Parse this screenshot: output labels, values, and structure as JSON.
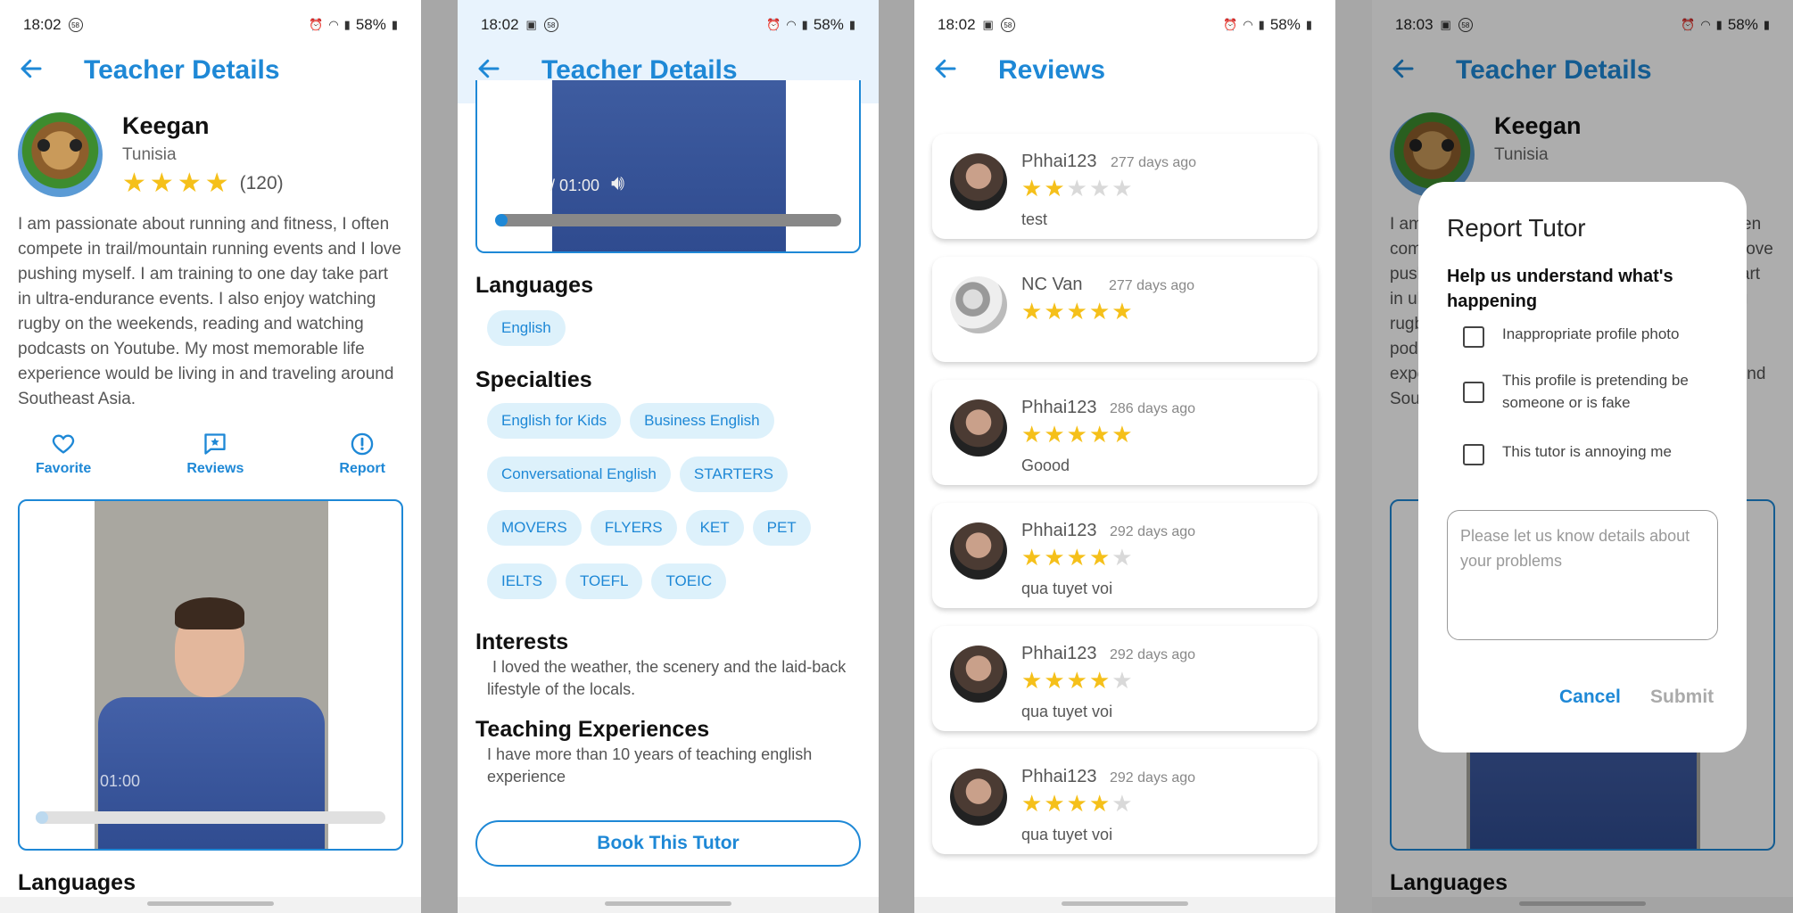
{
  "status": {
    "p1": {
      "time": "18:02",
      "battery": "58%"
    },
    "p2": {
      "time": "18:02",
      "battery": "58%"
    },
    "p3": {
      "time": "18:02",
      "battery": "58%"
    },
    "p4": {
      "time": "18:03",
      "battery": "58%"
    },
    "badge": "58"
  },
  "teacher": {
    "title": "Teacher Details",
    "name": "Keegan",
    "country": "Tunisia",
    "rating_count": "(120)",
    "rating": 4,
    "bio": "I am passionate about running and fitness, I often compete in trail/mountain running events and I love pushing myself. I am training to one day take part in ultra-endurance events. I also enjoy watching rugby on the weekends, reading and watching podcasts on Youtube. My most memorable life experience would be living in and traveling around Southeast Asia.",
    "actions": {
      "favorite": "Favorite",
      "reviews": "Reviews",
      "report": "Report"
    },
    "video_time": "01:00",
    "video_time_p2": "/ 01:00",
    "languages_heading": "Languages",
    "languages": [
      "English"
    ],
    "specialties_heading": "Specialties",
    "specialties": [
      "English for Kids",
      "Business English",
      "Conversational English",
      "STARTERS",
      "MOVERS",
      "FLYERS",
      "KET",
      "PET",
      "IELTS",
      "TOEFL",
      "TOEIC"
    ],
    "interests_heading": "Interests",
    "interests": "I loved the weather, the scenery and the laid-back lifestyle of the locals.",
    "experience_heading": "Teaching Experiences",
    "experience": "I have more than 10 years of teaching english experience",
    "book_button": "Book This Tutor"
  },
  "reviews": {
    "title": "Reviews",
    "items": [
      {
        "name": "Phhai123",
        "date": "277 days ago",
        "stars": 2,
        "text": "test"
      },
      {
        "name": "NC Van",
        "date": "277 days ago",
        "stars": 5,
        "text": ""
      },
      {
        "name": "Phhai123",
        "date": "286 days ago",
        "stars": 5,
        "text": "Goood"
      },
      {
        "name": "Phhai123",
        "date": "292 days ago",
        "stars": 4,
        "text": "qua tuyet voi"
      },
      {
        "name": "Phhai123",
        "date": "292 days ago",
        "stars": 4,
        "text": "qua tuyet voi"
      },
      {
        "name": "Phhai123",
        "date": "292 days ago",
        "stars": 4,
        "text": "qua tuyet voi"
      }
    ]
  },
  "report_dialog": {
    "title": "Report Tutor",
    "subtitle": "Help us understand what's happening",
    "options": [
      "Inappropriate profile photo",
      "This profile is pretending be someone or is fake",
      "This tutor is annoying me"
    ],
    "placeholder": "Please let us know details about your problems",
    "cancel": "Cancel",
    "submit": "Submit"
  },
  "colors": {
    "accent": "#1e88d6",
    "star": "#f5c01a",
    "chip_bg": "#ddf1fb"
  }
}
